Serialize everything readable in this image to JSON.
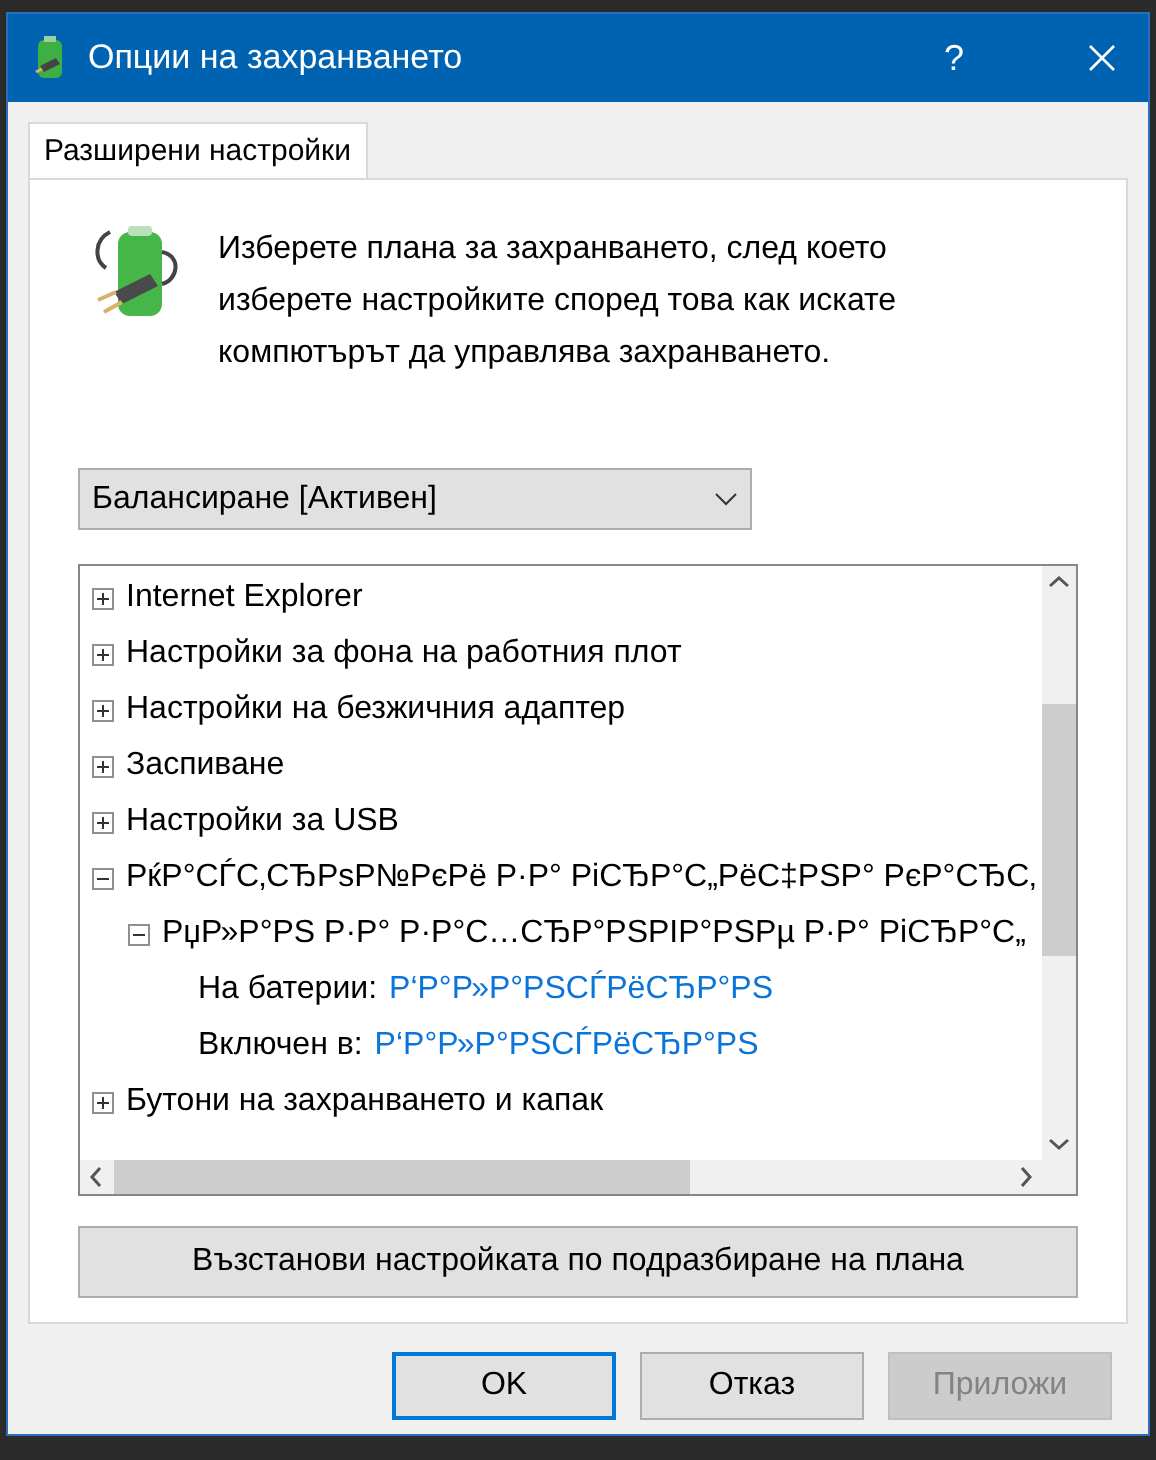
{
  "window": {
    "title": "Опции на захранването",
    "help": "?"
  },
  "tabs": [
    {
      "label": "Разширени настройки",
      "selected": true
    }
  ],
  "intro": "Изберете плана за захранването, след което изберете настройките според това как искате компютърът да управлява захранването.",
  "plan_dropdown": {
    "value": "Балансиране [Активен]"
  },
  "tree": [
    {
      "label": "Internet Explorer",
      "expanded": false
    },
    {
      "label": "Настройки за фона на работния плот",
      "expanded": false
    },
    {
      "label": "Настройки на безжичния адаптер",
      "expanded": false
    },
    {
      "label": "Заспиване",
      "expanded": false
    },
    {
      "label": "Настройки за USB",
      "expanded": false
    },
    {
      "label": "РќР°СЃС‚СЂРѕР№РєРё Р·Р° РіСЂР°С„РёС‡РЅР° РєР°СЂС‚",
      "expanded": true,
      "children": [
        {
          "label": "РџР»Р°РЅ Р·Р° Р·Р°С…СЂР°РЅРІР°РЅРµ Р·Р° РіСЂР°С„",
          "expanded": true,
          "children": [
            {
              "label": "На батерии:",
              "value": "Р‘Р°Р»Р°РЅСЃРёСЂР°РЅ"
            },
            {
              "label": "Включен в:",
              "value": "Р‘Р°Р»Р°РЅСЃРёСЂР°РЅ"
            }
          ]
        }
      ]
    },
    {
      "label": "Бутони на захранването и капак",
      "expanded": false
    }
  ],
  "restore_button": "Възстанови настройката по подразбиране на плана",
  "buttons": [
    {
      "label": "OK",
      "disabled": false,
      "default": true
    },
    {
      "label": "Отказ",
      "disabled": false,
      "default": false
    },
    {
      "label": "Приложи",
      "disabled": true,
      "default": false
    }
  ]
}
